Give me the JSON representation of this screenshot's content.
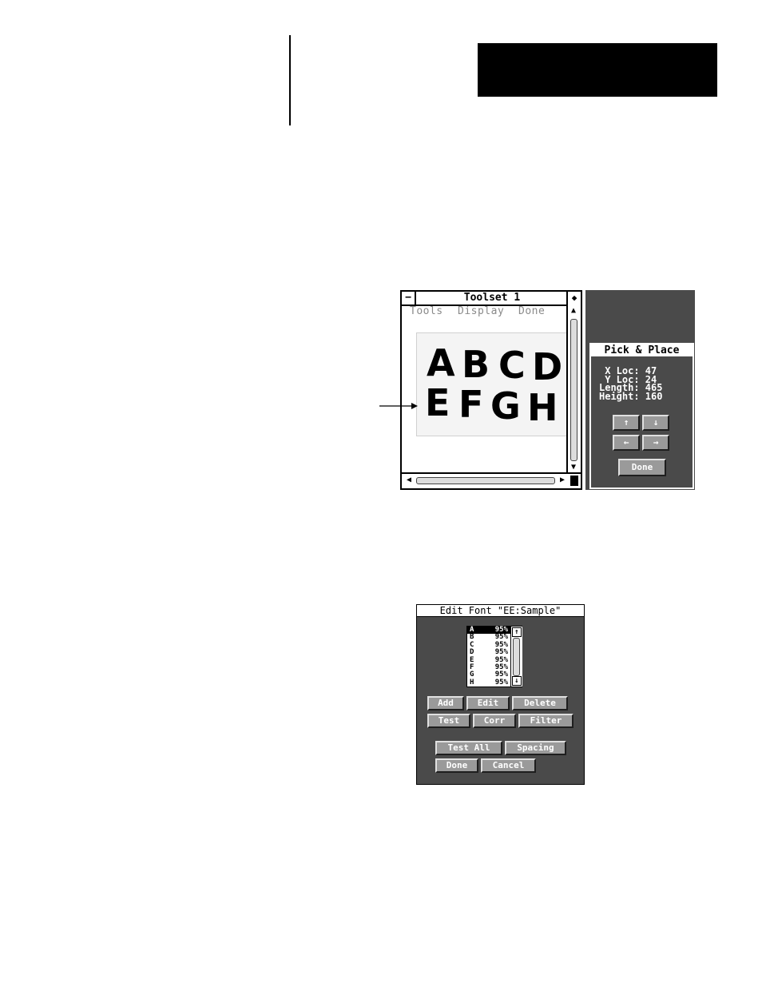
{
  "toolset": {
    "title": "Toolset 1",
    "close_glyph": "−",
    "max_glyph": "◆",
    "menu": [
      "Tools",
      "Display",
      "Done"
    ],
    "image_letters_row1": [
      "A",
      "B",
      "C",
      "D"
    ],
    "image_letters_row2": [
      "E",
      "F",
      "G",
      "H"
    ],
    "scroll_up_glyph": "▲",
    "scroll_down_glyph": "▼",
    "scroll_left_glyph": "◀",
    "scroll_right_glyph": "▶"
  },
  "pick_place": {
    "title": "Pick & Place",
    "lines": [
      " X Loc: 47",
      " Y Loc: 24",
      "Length: 465",
      "Height: 160"
    ],
    "up_glyph": "↑",
    "down_glyph": "↓",
    "left_glyph": "←",
    "right_glyph": "→",
    "done_label": "Done"
  },
  "edit_font": {
    "title": "Edit Font \"EE:Sample\"",
    "rows": [
      {
        "letter": "A",
        "score": "95%"
      },
      {
        "letter": "B",
        "score": "95%"
      },
      {
        "letter": "C",
        "score": "95%"
      },
      {
        "letter": "D",
        "score": "95%"
      },
      {
        "letter": "E",
        "score": "95%"
      },
      {
        "letter": "F",
        "score": "95%"
      },
      {
        "letter": "G",
        "score": "95%"
      },
      {
        "letter": "H",
        "score": "95%"
      }
    ],
    "scroll_up_glyph": "↑",
    "scroll_down_glyph": "↓",
    "buttons": {
      "add": "Add",
      "edit": "Edit",
      "delete": "Delete",
      "test": "Test",
      "corr": "Corr",
      "filter": "Filter",
      "test_all": "Test All",
      "spacing": "Spacing",
      "done": "Done",
      "cancel": "Cancel"
    }
  }
}
